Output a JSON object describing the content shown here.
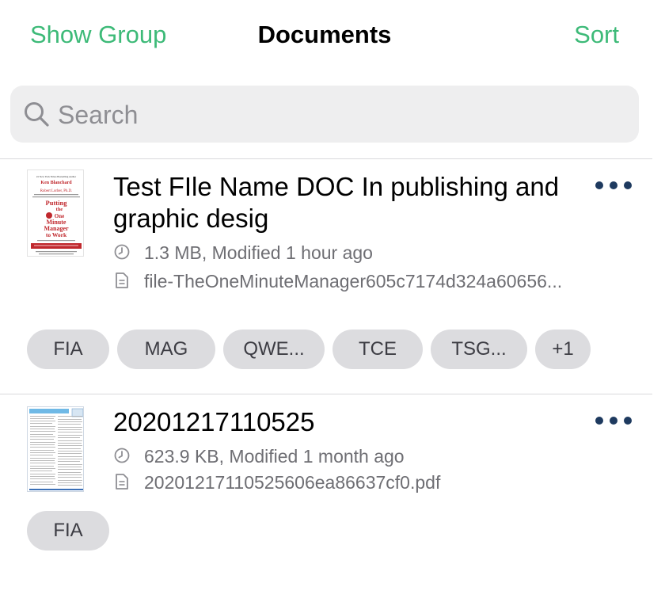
{
  "navbar": {
    "left_label": "Show Group",
    "title": "Documents",
    "right_label": "Sort"
  },
  "search": {
    "placeholder": "Search",
    "icon": "search-icon"
  },
  "documents": [
    {
      "title": "Test FIle Name DOC In publishing and graphic desig",
      "size_modified": "1.3 MB, Modified 1 hour ago",
      "filename": "file-TheOneMinuteManager605c7174d324a60656...",
      "thumbnail_text": {
        "top": "#1 New York Times Bestselling Author",
        "author1": "Ken Blanchard",
        "author2": "Robert Lorber, Ph.D.",
        "line1": "Putting",
        "line2": "the",
        "line3": "One",
        "line4": "Minute",
        "line5": "Manager",
        "line6": "to Work"
      },
      "tags": [
        "FIA",
        "MAG",
        "QWE...",
        "TCE",
        "TSG...",
        "+1"
      ]
    },
    {
      "title": "20201217110525",
      "size_modified": "623.9 KB, Modified 1 month ago",
      "filename": "20201217110525606ea86637cf0.pdf",
      "tags": [
        "FIA"
      ]
    }
  ],
  "icons": {
    "clock": "clock-icon",
    "file": "document-icon",
    "more": "more-icon"
  },
  "colors": {
    "accent": "#3dba78",
    "more_dots": "#1e3a5f",
    "tag_bg": "#dcdcdf",
    "search_bg": "#eeeeef"
  }
}
